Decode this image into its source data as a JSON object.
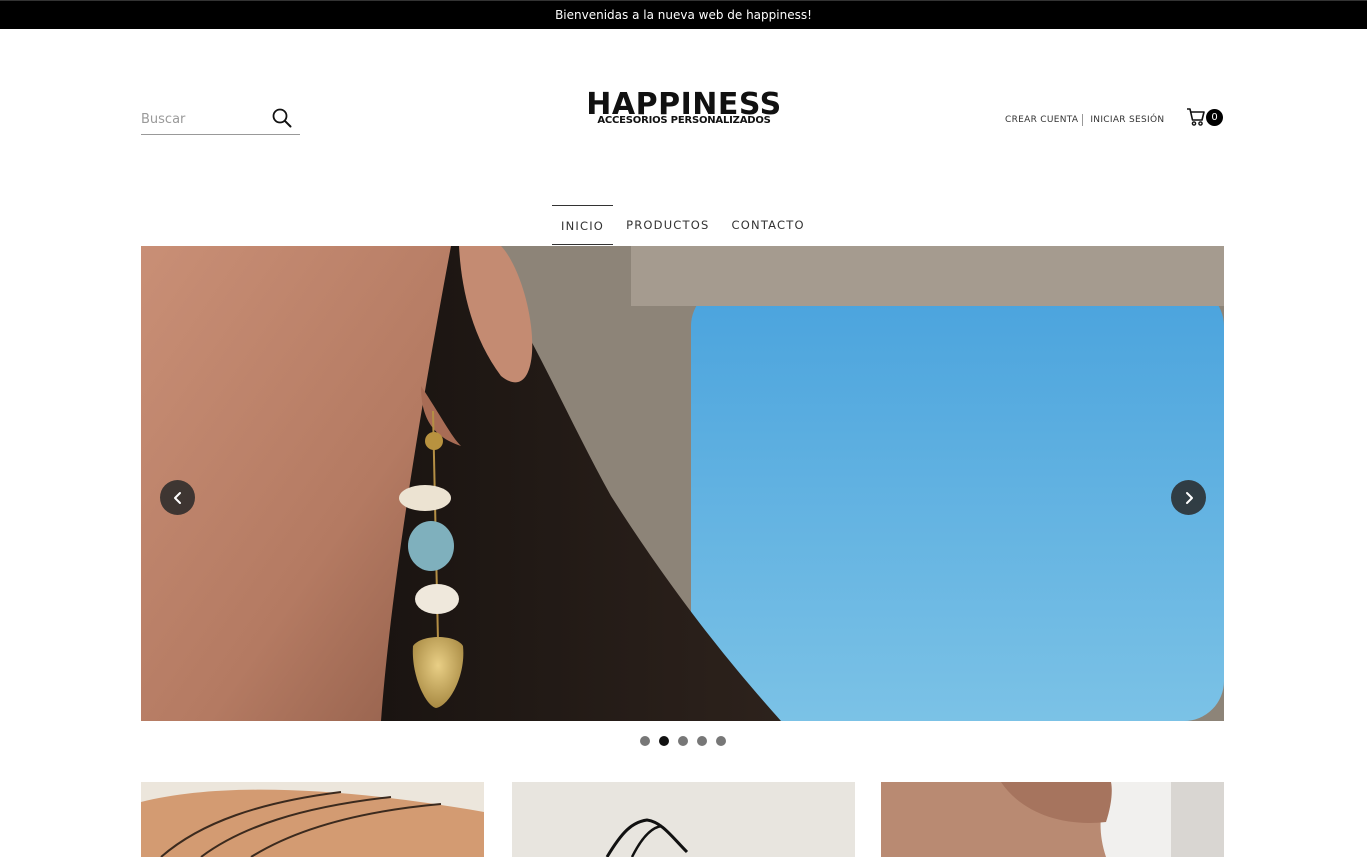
{
  "announcement": "Bienvenidas a la nueva web de happiness!",
  "search": {
    "placeholder": "Buscar",
    "icon": "search-icon"
  },
  "logo": {
    "main": "HAPPINESS",
    "sub": "ACCESORIOS PERSONALIZADOS"
  },
  "account": {
    "create": "CREAR CUENTA",
    "login": "INICIAR SESIÓN"
  },
  "cart": {
    "count": "0",
    "icon": "cart-icon"
  },
  "nav": {
    "items": [
      {
        "label": "INICIO",
        "active": true
      },
      {
        "label": "PRODUCTOS",
        "active": false
      },
      {
        "label": "CONTACTO",
        "active": false
      }
    ]
  },
  "slider": {
    "slides": 5,
    "active_slide": 2,
    "icons": [
      "chevron-left-icon",
      "chevron-right-icon"
    ]
  },
  "colors": {
    "announcement_bg": "#000000",
    "accent": "#111111",
    "text": "#333333"
  }
}
